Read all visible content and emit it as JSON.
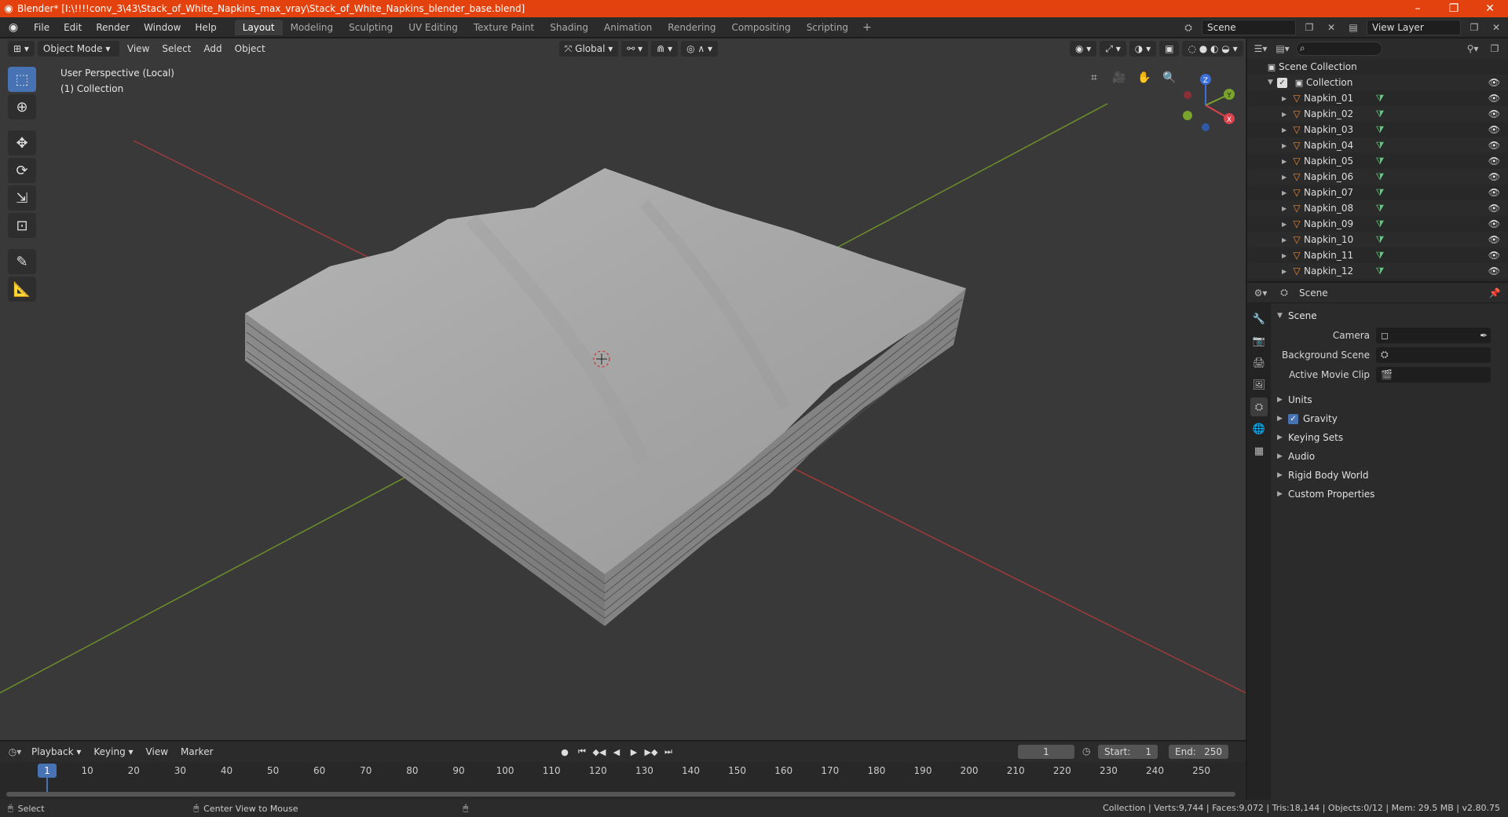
{
  "titlebar": {
    "title": "Blender* [I:\\!!!!conv_3\\43\\Stack_of_White_Napkins_max_vray\\Stack_of_White_Napkins_blender_base.blend]",
    "minimize": "–",
    "maximize": "❐",
    "close": "✕"
  },
  "menu": [
    "File",
    "Edit",
    "Render",
    "Window",
    "Help"
  ],
  "workspaces": [
    "Layout",
    "Modeling",
    "Sculpting",
    "UV Editing",
    "Texture Paint",
    "Shading",
    "Animation",
    "Rendering",
    "Compositing",
    "Scripting"
  ],
  "workspace_active": "Layout",
  "topright": {
    "scene": "Scene",
    "view_layer": "View Layer"
  },
  "viewport": {
    "mode": "Object Mode",
    "menus": [
      "View",
      "Select",
      "Add",
      "Object"
    ],
    "transform_orientation": "Global",
    "info_line1": "User Perspective (Local)",
    "info_line2": "(1) Collection",
    "gizmo": {
      "z": "Z",
      "y": "Y",
      "x": "X"
    }
  },
  "outliner": {
    "root": "Scene Collection",
    "collection": "Collection",
    "objects": [
      "Napkin_01",
      "Napkin_02",
      "Napkin_03",
      "Napkin_04",
      "Napkin_05",
      "Napkin_06",
      "Napkin_07",
      "Napkin_08",
      "Napkin_09",
      "Napkin_10",
      "Napkin_11",
      "Napkin_12"
    ]
  },
  "properties": {
    "context": "Scene",
    "panel": "Scene",
    "camera_label": "Camera",
    "background_scene_label": "Background Scene",
    "active_movie_clip_label": "Active Movie Clip",
    "subpanels": {
      "units": "Units",
      "gravity": "Gravity",
      "keying_sets": "Keying Sets",
      "audio": "Audio",
      "rigid_body_world": "Rigid Body World",
      "custom_properties": "Custom Properties"
    }
  },
  "timeline": {
    "menus": [
      "Playback",
      "Keying",
      "View",
      "Marker"
    ],
    "current_frame": "1",
    "start_label": "Start:",
    "start": "1",
    "end_label": "End:",
    "end": "250",
    "ticks": [
      "10",
      "20",
      "30",
      "40",
      "50",
      "60",
      "70",
      "80",
      "90",
      "100",
      "110",
      "120",
      "130",
      "140",
      "150",
      "160",
      "170",
      "180",
      "190",
      "200",
      "210",
      "220",
      "230",
      "240",
      "250"
    ],
    "cursor_label": "1"
  },
  "statusbar": {
    "select": "Select",
    "center_view": "Center View to Mouse",
    "stats": "Collection | Verts:9,744 | Faces:9,072 | Tris:18,144 | Objects:0/12 | Mem: 29.5 MB | v2.80.75"
  }
}
